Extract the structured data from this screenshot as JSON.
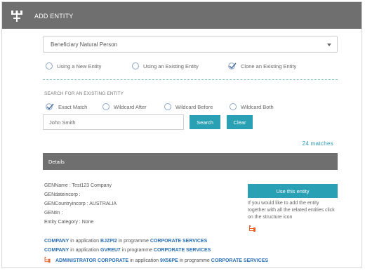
{
  "header": {
    "title": "ADD ENTITY",
    "icon": "structure-icon"
  },
  "entity_type": {
    "selected": "Beneficiary Natural Person"
  },
  "mode_options": [
    {
      "label": "Using a New Entity",
      "checked": false
    },
    {
      "label": "Using an Existing Entity",
      "checked": false
    },
    {
      "label": "Clone an Existing Entity",
      "checked": true
    }
  ],
  "search": {
    "section_label": "SEARCH FOR AN EXISTING ENTITY",
    "match_options": [
      {
        "label": "Exact Match",
        "checked": true
      },
      {
        "label": "Wildcard After",
        "checked": false
      },
      {
        "label": "Wildcard Before",
        "checked": false
      },
      {
        "label": "Wildcard Both",
        "checked": false
      }
    ],
    "query": "John Smith",
    "search_button": "Search",
    "clear_button": "Clear",
    "matches": "24 matches"
  },
  "details": {
    "title": "Details",
    "fields": [
      "GENName : Test123 Company",
      "GENdateincorp :",
      "GENCountryincorp : AUSTRALIA",
      "GENtin :",
      "Entity Category : None"
    ],
    "use_button": "Use this entity",
    "help_text": "If you would like to add the entity together with all the related entities click on the structure icon"
  },
  "applications": [
    {
      "role": "COMPANY",
      "in_app": " in application ",
      "app_id": "BJZPI2",
      "in_prog": " in programme ",
      "programme": "CORPORATE SERVICES",
      "has_icon": false
    },
    {
      "role": "COMPANY",
      "in_app": " in application ",
      "app_id": "GVREU7",
      "in_prog": " in programme ",
      "programme": "CORPORATE SERVICES",
      "has_icon": false
    },
    {
      "role": "ADMINISTRATOR CORPORATE",
      "in_app": " in application ",
      "app_id": "9X56PE",
      "in_prog": " in programme ",
      "programme": "CORPORATE SERVICES",
      "has_icon": true
    }
  ],
  "colors": {
    "accent": "#2aa0b4",
    "header": "#6f6f6f",
    "link": "#2a6fb5",
    "structure_icon": "#e8602c"
  }
}
